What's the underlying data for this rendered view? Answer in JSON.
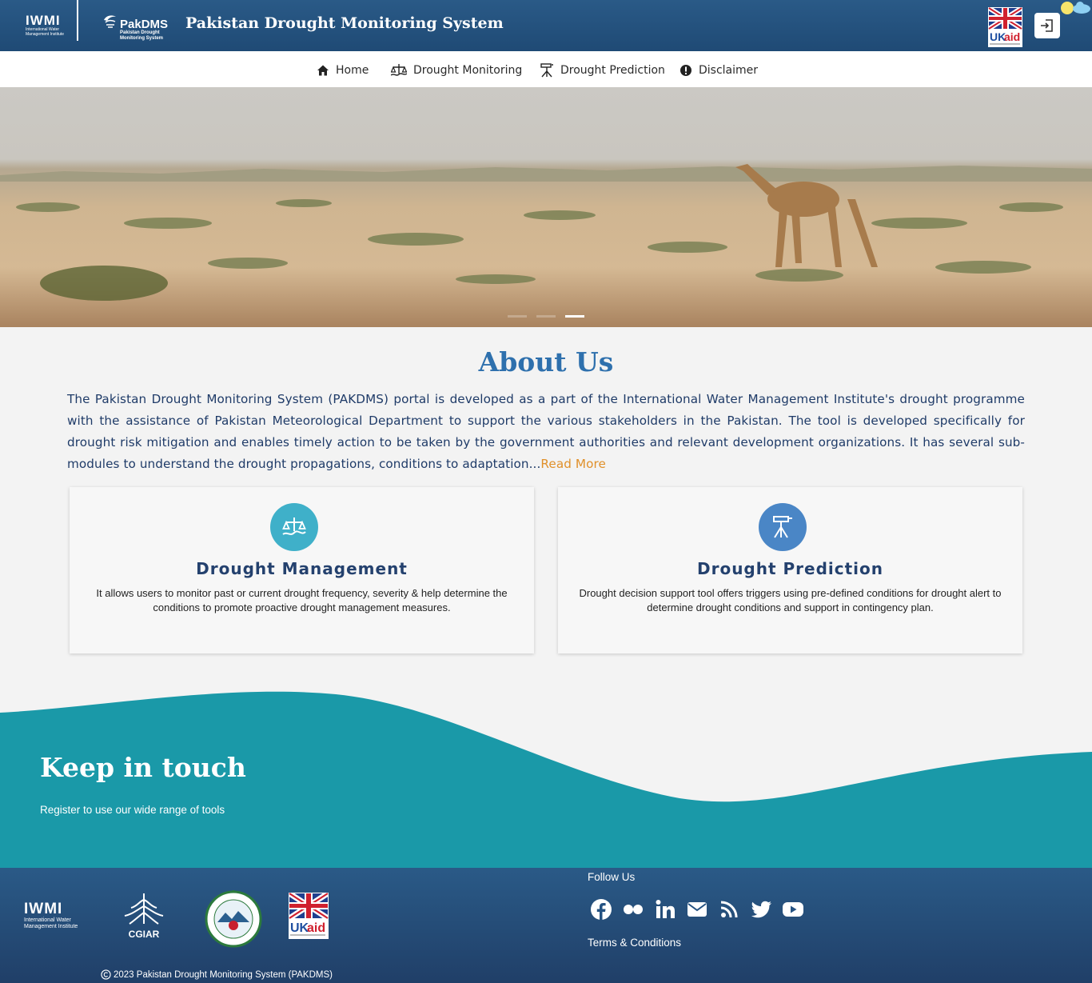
{
  "header": {
    "iwmi_logo_text": "IWMI",
    "iwmi_logo_subtext": "International Water Management Institute",
    "pak_logo_name": "PakDMS",
    "pak_logo_subtext": "Pakistan Drought Monitoring System",
    "title": "Pakistan Drought Monitoring System",
    "ukaid_icon": "ukaid-flag-logo",
    "login_icon": "login-icon",
    "weather_icon": "sun-cloud-icon"
  },
  "nav": {
    "items": [
      {
        "label": "Home",
        "icon": "home-icon"
      },
      {
        "label": "Drought Monitoring",
        "icon": "scale-icon"
      },
      {
        "label": "Drought Prediction",
        "icon": "tripod-icon"
      },
      {
        "label": "Disclaimer",
        "icon": "alert-icon"
      }
    ]
  },
  "hero": {
    "slide_count": 3,
    "active_slide": 3
  },
  "about": {
    "title": "About Us",
    "text": "The Pakistan Drought Monitoring System (PAKDMS) portal is developed as a part of the International Water Management Institute's drought programme with the assistance of Pakistan Meteorological Department to support the various stakeholders in the Pakistan. The tool is developed specifically for drought risk mitigation and enables timely action to be taken by the government authorities and relevant development organizations. It has several sub-modules to understand the drought propagations, conditions to adaptation...",
    "read_more": "Read More"
  },
  "cards": [
    {
      "title": "Drought Management",
      "description": "It allows users to monitor past or current drought frequency, severity & help determine the conditions to promote proactive drought management measures.",
      "icon": "scale-icon",
      "color": "#3fb0c9"
    },
    {
      "title": "Drought Prediction",
      "description": "Drought decision support tool offers triggers using pre-defined conditions for drought alert to determine drought conditions and support in contingency plan.",
      "icon": "tripod-icon",
      "color": "#4a86c6"
    }
  ],
  "keep_in_touch": {
    "title": "Keep in touch",
    "subtitle": "Register to use our wide range of tools"
  },
  "footer": {
    "iwmi_text": "IWMI",
    "iwmi_subtext": "International Water Management Institute",
    "cgiar_text": "CGIAR",
    "pmd_logo": "pakistan-meteorological-department-seal",
    "ukaid_logo": "ukaid-flag-logo",
    "follow_label": "Follow Us",
    "social": [
      "facebook-icon",
      "flickr-icon",
      "linkedin-icon",
      "email-icon",
      "rss-icon",
      "twitter-icon",
      "youtube-icon"
    ],
    "terms": "Terms & Conditions",
    "copyright": "2023 Pakistan Drought Monitoring System (PAKDMS)"
  },
  "colors": {
    "header_bg": "#245282",
    "title_blue": "#2e70ad",
    "teal": "#1a99a8",
    "read_more": "#e0902a"
  }
}
